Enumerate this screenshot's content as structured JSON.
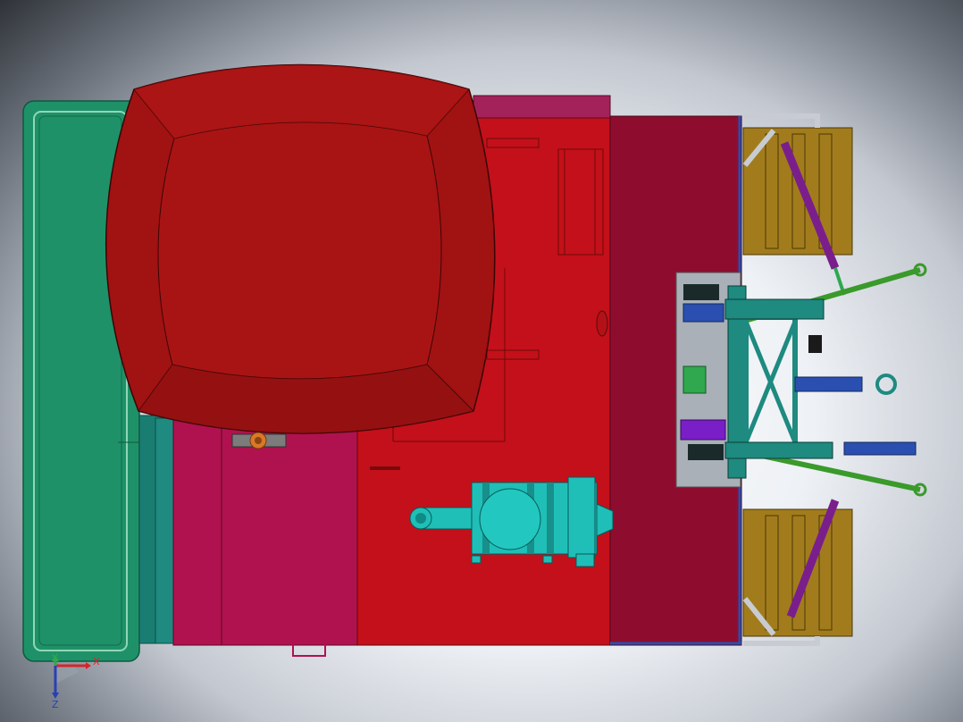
{
  "view": {
    "background_top": "#2f3338",
    "background_center": "#ffffff"
  },
  "triad": {
    "x_label": "X",
    "y_label": "Y",
    "z_label": "Z",
    "x_color": "#d8232a",
    "y_color": "#2fa84f",
    "z_color": "#2a3fb5"
  },
  "model": {
    "colors": {
      "left_panel": "#1f9168",
      "cab_roof": "#a11212",
      "main_body": "#c4101a",
      "hood": "#8e0d2f",
      "side_panel": "#b0124f",
      "air_filter": "#1fbfb8",
      "frame": "#1e8a80",
      "hitch_green": "#3a9a2b",
      "cylinder_purple": "#7a1e8c",
      "wheel_tread": "#a27c1c",
      "cylinder_blue": "#2a4fb0"
    }
  }
}
